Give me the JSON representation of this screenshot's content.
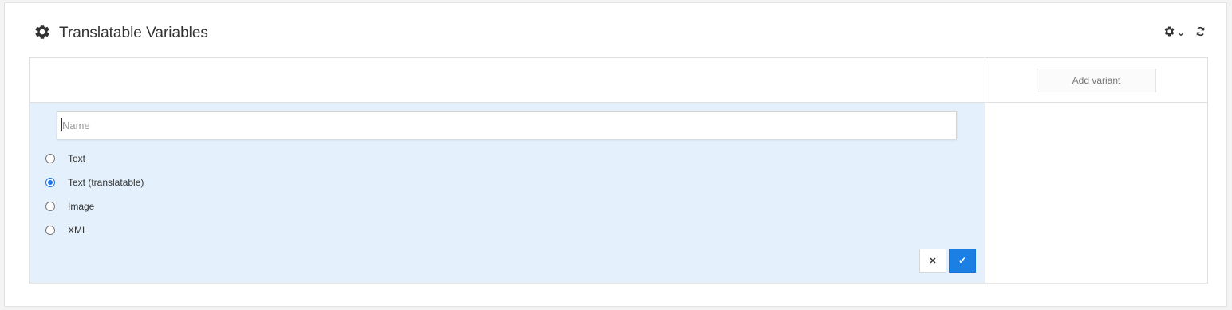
{
  "widget": {
    "title": "Translatable Variables",
    "title_icon": "gear-icon",
    "tools": {
      "settings_icon": "gear-icon",
      "dropdown_icon": "chevron-down-icon",
      "refresh_icon": "refresh-icon"
    }
  },
  "grid": {
    "add_variant_label": "Add variant"
  },
  "editor": {
    "name_placeholder": "Name",
    "name_value": "",
    "options": [
      {
        "label": "Text",
        "checked": false
      },
      {
        "label": "Text (translatable)",
        "checked": true
      },
      {
        "label": "Image",
        "checked": false
      },
      {
        "label": "XML",
        "checked": false
      }
    ],
    "cancel_symbol": "✕",
    "confirm_symbol": "✔"
  },
  "colors": {
    "accent": "#1b7fe3",
    "editor_background": "#e4f1fc"
  }
}
